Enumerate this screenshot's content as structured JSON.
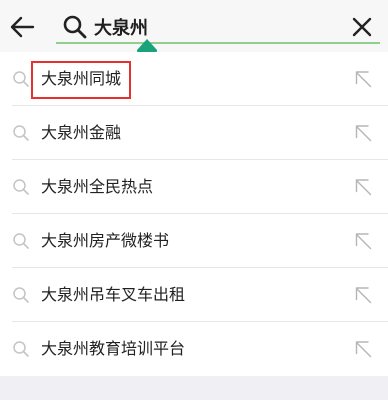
{
  "header": {
    "back_icon": "arrow-left",
    "search_icon": "magnifier",
    "query": "大泉州",
    "clear_icon": "close-x",
    "accent_color": "#8fce8c",
    "cursor_handle_color": "#1aa37a"
  },
  "suggestions": [
    {
      "label": "大泉州同城",
      "highlighted": true
    },
    {
      "label": "大泉州金融",
      "highlighted": false
    },
    {
      "label": "大泉州全民热点",
      "highlighted": false
    },
    {
      "label": "大泉州房产微楼书",
      "highlighted": false
    },
    {
      "label": "大泉州吊车叉车出租",
      "highlighted": false
    },
    {
      "label": "大泉州教育培训平台",
      "highlighted": false
    }
  ],
  "suggestion_icons": {
    "leading": "search-icon",
    "trailing": "fill-query-arrow-icon"
  },
  "highlight_color": "#e5312f"
}
